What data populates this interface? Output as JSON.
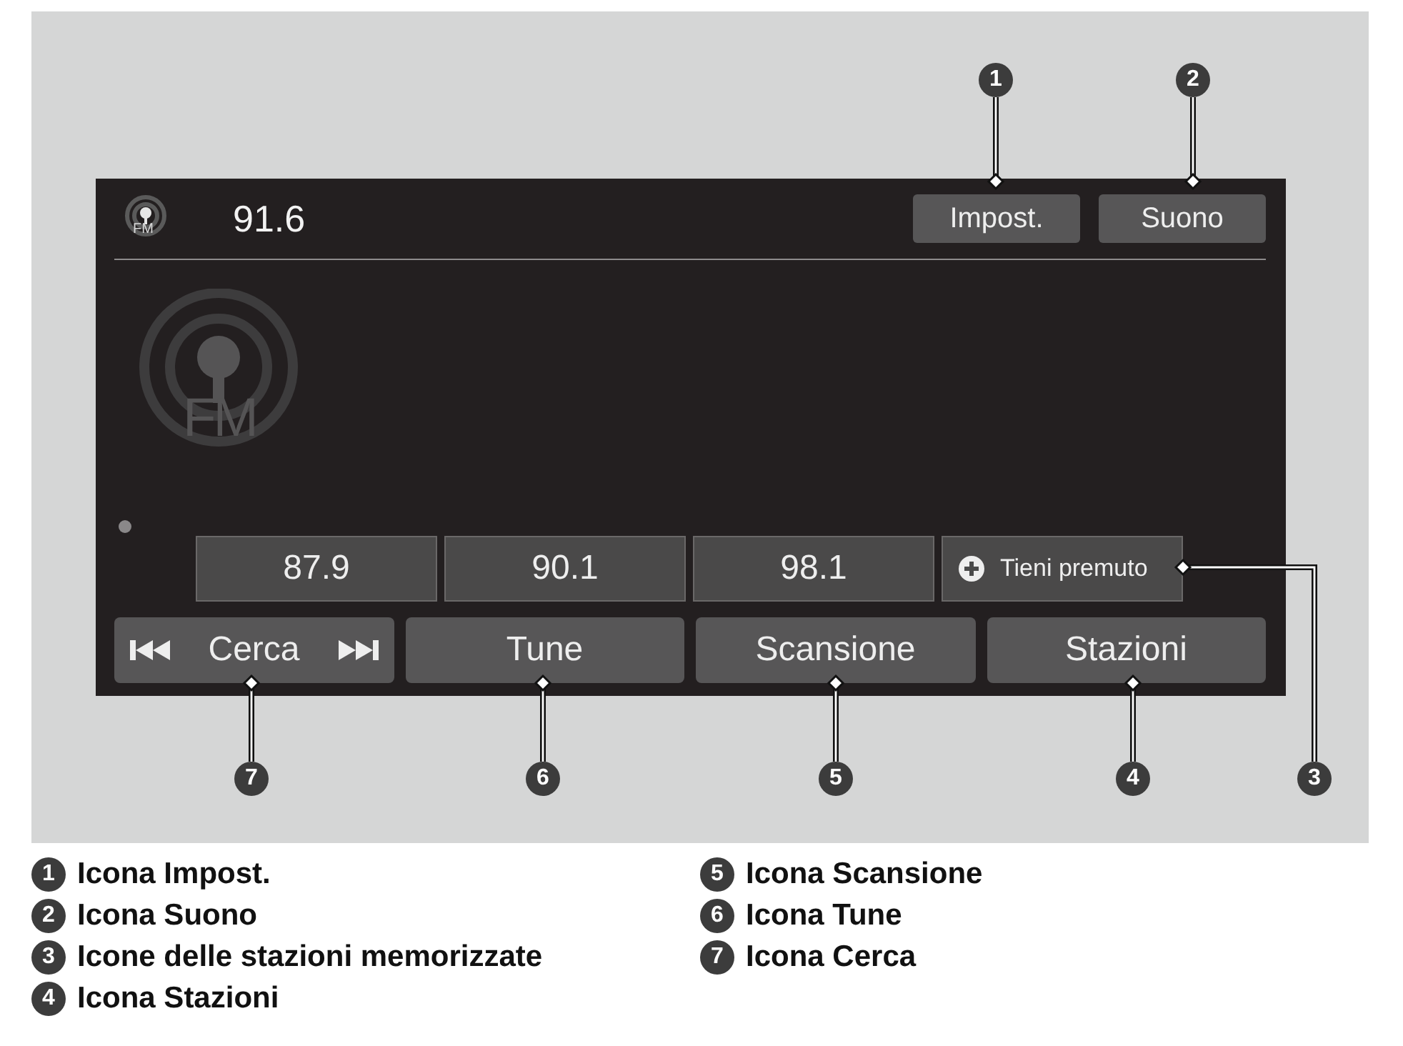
{
  "screen": {
    "header_icon_label": "FM",
    "frequency": "91.6",
    "top_buttons": [
      "Impost.",
      "Suono"
    ],
    "artwork_label": "FM",
    "presets": [
      {
        "label": "87.9",
        "kind": "station"
      },
      {
        "label": "90.1",
        "kind": "station"
      },
      {
        "label": "98.1",
        "kind": "station"
      },
      {
        "label": "Tieni premuto",
        "kind": "add"
      }
    ],
    "controls": [
      {
        "label": "Cerca",
        "kind": "seek"
      },
      {
        "label": "Tune",
        "kind": "plain"
      },
      {
        "label": "Scansione",
        "kind": "plain"
      },
      {
        "label": "Stazioni",
        "kind": "plain"
      }
    ]
  },
  "callouts": [
    "1",
    "2",
    "7",
    "6",
    "5",
    "4",
    "3"
  ],
  "legend": [
    {
      "number": "1",
      "text": "Icona Impost."
    },
    {
      "number": "2",
      "text": "Icona Suono"
    },
    {
      "number": "3",
      "text": "Icone delle stazioni memorizzate"
    },
    {
      "number": "4",
      "text": "Icona Stazioni"
    },
    {
      "number": "5",
      "text": "Icona Scansione"
    },
    {
      "number": "6",
      "text": "Icona Tune"
    },
    {
      "number": "7",
      "text": "Icona Cerca"
    }
  ]
}
